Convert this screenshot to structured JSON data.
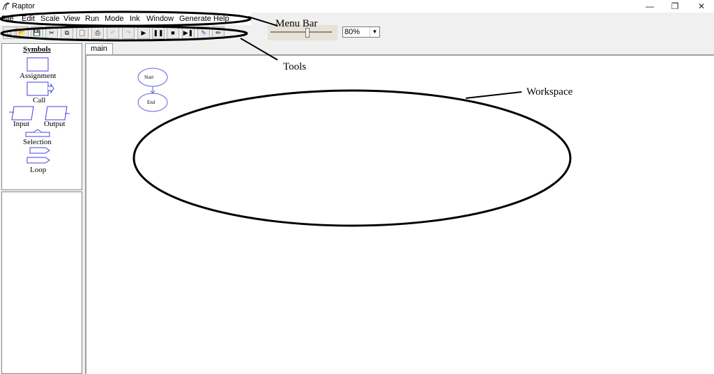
{
  "window": {
    "title": "Raptor",
    "controls": {
      "minimize": "—",
      "maximize": "❐",
      "close": "✕"
    }
  },
  "menu": {
    "items": [
      "File",
      "Edit",
      "Scale",
      "View",
      "Run",
      "Mode",
      "Ink",
      "Window",
      "Generate",
      "Help"
    ]
  },
  "toolbar": {
    "buttons": [
      {
        "name": "new-icon",
        "glyph": "□"
      },
      {
        "name": "open-icon",
        "glyph": "📂"
      },
      {
        "name": "save-icon",
        "glyph": "💾"
      },
      {
        "name": "cut-icon",
        "glyph": "✂"
      },
      {
        "name": "copy-icon",
        "glyph": "⧉"
      },
      {
        "name": "paste-icon",
        "glyph": "📋"
      },
      {
        "name": "print-icon",
        "glyph": "⎙"
      },
      {
        "name": "undo-icon",
        "glyph": "↶"
      },
      {
        "name": "redo-icon",
        "glyph": "↷"
      },
      {
        "name": "run-icon",
        "glyph": "▶"
      },
      {
        "name": "pause-icon",
        "glyph": "❚❚"
      },
      {
        "name": "stop-icon",
        "glyph": "■"
      },
      {
        "name": "step-icon",
        "glyph": "▶❚"
      },
      {
        "name": "ink-icon",
        "glyph": "✎"
      },
      {
        "name": "pencil-icon",
        "glyph": "✏"
      }
    ],
    "zoom_value": "80%"
  },
  "symbols": {
    "title": "Symbols",
    "assignment": "Assignment",
    "call": "Call",
    "input": "Input",
    "output": "Output",
    "selection": "Selection",
    "loop": "Loop"
  },
  "tabs": {
    "main": "main"
  },
  "flowchart": {
    "start": "Start",
    "end": "End"
  },
  "annotations": {
    "menu_bar": "Menu Bar",
    "tools": "Tools",
    "workspace": "Workspace"
  },
  "colors": {
    "symbol_stroke": "#4040e0",
    "workspace_bg": "#ffffff"
  }
}
